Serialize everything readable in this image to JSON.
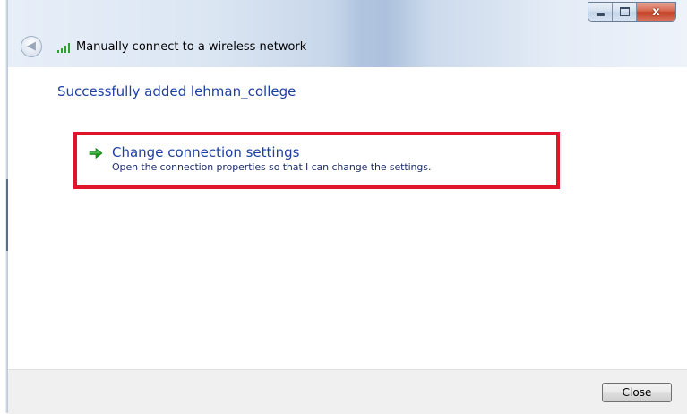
{
  "window": {
    "title": "Manually connect to a wireless network",
    "controls": {
      "minimize_icon": "minimize-icon",
      "maximize_icon": "maximize-icon",
      "close_glyph": "x"
    },
    "back_icon": "back-arrow-icon",
    "title_icon": "wireless-signal-icon"
  },
  "content": {
    "heading": "Successfully added lehman_college",
    "option": {
      "icon": "green-arrow-icon",
      "title": "Change connection settings",
      "description": "Open the connection properties so that I can change the settings."
    },
    "highlight_color": "#e0142a"
  },
  "footer": {
    "close_label": "Close"
  },
  "colors": {
    "link_blue": "#1e3fa2",
    "arrow_green": "#1a9a1a",
    "close_red": "#c23f25"
  }
}
